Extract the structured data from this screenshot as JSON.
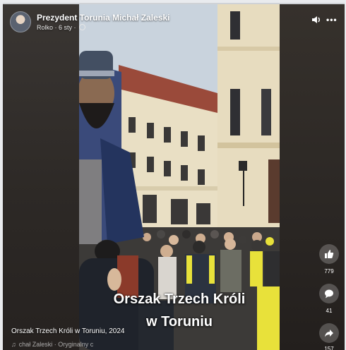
{
  "header": {
    "page_name": "Prezydent Torunia Michał Zaleski",
    "author_and_date": "Rolko · 6 sty ·"
  },
  "video": {
    "overlay_line1": "Orszak Trzech Króli",
    "overlay_line2": "w Toruniu"
  },
  "caption": {
    "text": "Orszak Trzech Króli w Toruniu, 2024",
    "audio": "chał Zaleski · Oryginalny c"
  },
  "actions": {
    "likes": "779",
    "comments": "41",
    "shares": "157"
  },
  "colors": {
    "sky": "#c9d3dd",
    "building_cream": "#e9dfc4",
    "brick_roof": "#9a4a3a",
    "vest_yellow": "#e8e13a"
  },
  "icons": {
    "speaker": "speaker-icon",
    "more": "more-options-icon",
    "like": "thumbs-up-icon",
    "comment": "comment-icon",
    "share": "share-arrow-icon",
    "music": "music-note-icon"
  }
}
